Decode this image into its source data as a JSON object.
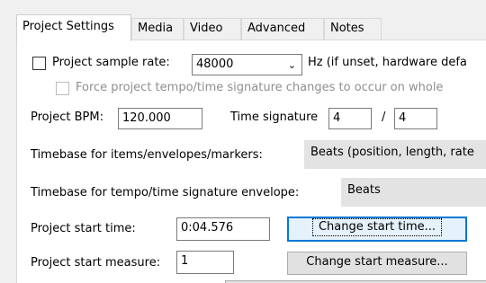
{
  "tabs": [
    {
      "label": "Project Settings",
      "active": true
    },
    {
      "label": "Media",
      "active": false
    },
    {
      "label": "Video",
      "active": false
    },
    {
      "label": "Advanced",
      "active": false
    },
    {
      "label": "Notes",
      "active": false
    }
  ],
  "sample_rate": {
    "checkbox_label": "Project sample rate:",
    "checked": false,
    "value": "48000",
    "hint": "Hz (if unset, hardware defa"
  },
  "force_tempo": {
    "label": "Force project tempo/time signature changes to occur on whole",
    "checked": false,
    "disabled": true
  },
  "bpm": {
    "label": "Project BPM:",
    "value": "120.000"
  },
  "time_signature": {
    "label": "Time signature",
    "numerator": "4",
    "separator": "/",
    "denominator": "4"
  },
  "timebase_items": {
    "label": "Timebase for items/envelopes/markers:",
    "value": "Beats (position, length, rate"
  },
  "timebase_tempo": {
    "label": "Timebase for tempo/time signature envelope:",
    "value": "Beats"
  },
  "start_time": {
    "label": "Project start time:",
    "value": "0:04.576",
    "button": "Change start time..."
  },
  "start_measure": {
    "label": "Project start measure:",
    "value": "1",
    "button": "Change start measure..."
  },
  "icons": {
    "dropdown": "chevron-down-icon",
    "checkbox": "checkbox-icon"
  }
}
